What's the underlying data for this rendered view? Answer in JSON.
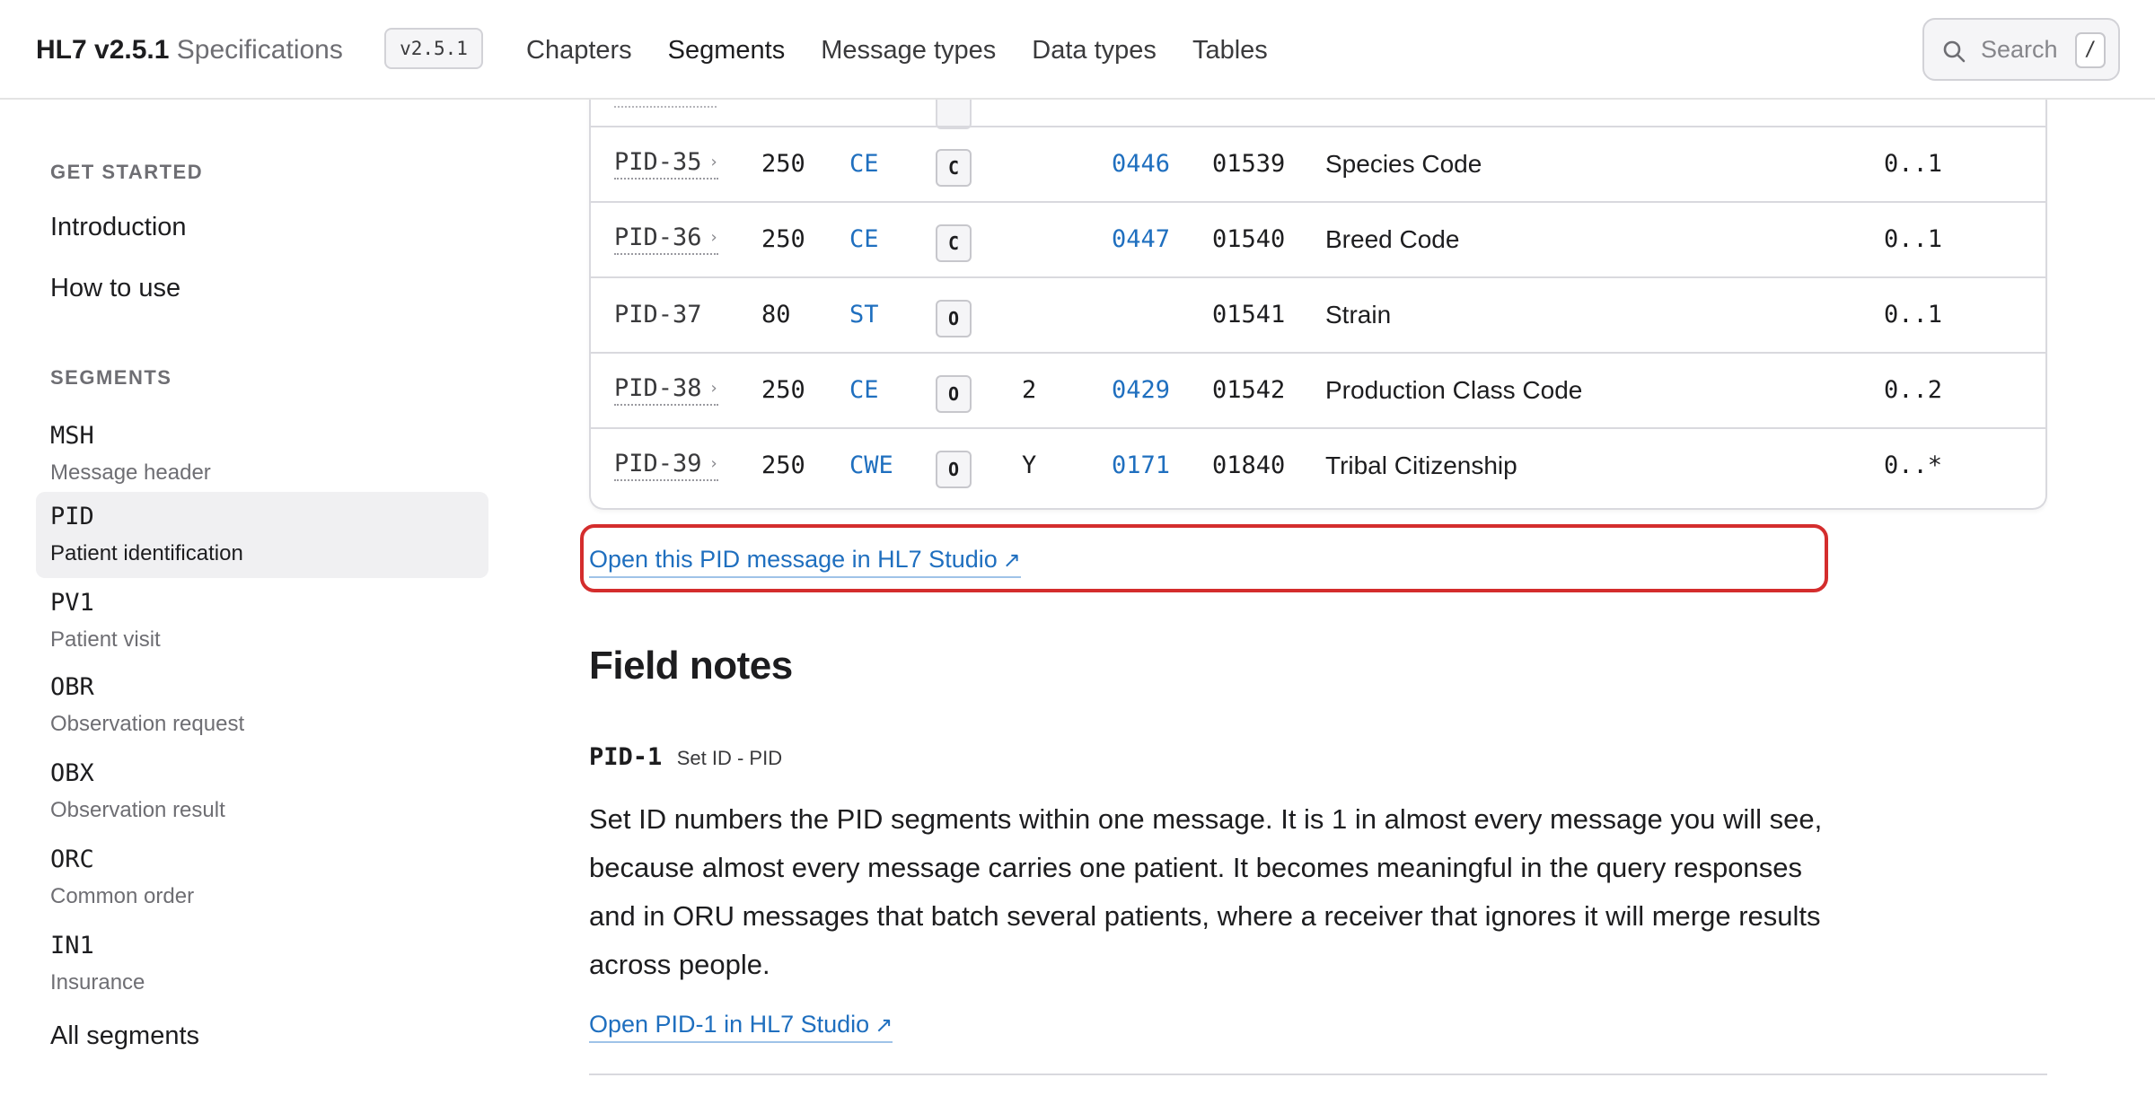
{
  "header": {
    "brand_strong": "HL7 v2.5.1",
    "brand_light": "Specifications",
    "version": "v2.5.1",
    "nav": [
      "Chapters",
      "Segments",
      "Message types",
      "Data types",
      "Tables"
    ],
    "active_nav": "Segments",
    "search": {
      "label": "Search",
      "shortcut": "/"
    }
  },
  "sidebar": {
    "get_started_heading": "GET STARTED",
    "introduction": "Introduction",
    "how_to_use": "How to use",
    "segments_heading": "SEGMENTS",
    "segments": [
      {
        "code": "MSH",
        "desc": "Message header"
      },
      {
        "code": "PID",
        "desc": "Patient identification"
      },
      {
        "code": "PV1",
        "desc": "Patient visit"
      },
      {
        "code": "OBR",
        "desc": "Observation request"
      },
      {
        "code": "OBX",
        "desc": "Observation result"
      },
      {
        "code": "ORC",
        "desc": "Common order"
      },
      {
        "code": "IN1",
        "desc": "Insurance"
      }
    ],
    "active_segment": "PID",
    "all_segments": "All segments"
  },
  "fields_table": {
    "rows": [
      {
        "field": "PID-35",
        "linked": true,
        "len": "250",
        "dt": "CE",
        "opt": "C",
        "rep": "",
        "table": "0446",
        "item": "01539",
        "name": "Species Code",
        "card": "0..1"
      },
      {
        "field": "PID-36",
        "linked": true,
        "len": "250",
        "dt": "CE",
        "opt": "C",
        "rep": "",
        "table": "0447",
        "item": "01540",
        "name": "Breed Code",
        "card": "0..1"
      },
      {
        "field": "PID-37",
        "linked": false,
        "len": "80",
        "dt": "ST",
        "opt": "O",
        "rep": "",
        "table": "",
        "item": "01541",
        "name": "Strain",
        "card": "0..1"
      },
      {
        "field": "PID-38",
        "linked": true,
        "len": "250",
        "dt": "CE",
        "opt": "O",
        "rep": "2",
        "table": "0429",
        "item": "01542",
        "name": "Production Class Code",
        "card": "0..2"
      },
      {
        "field": "PID-39",
        "linked": true,
        "len": "250",
        "dt": "CWE",
        "opt": "O",
        "rep": "Y",
        "table": "0171",
        "item": "01840",
        "name": "Tribal Citizenship",
        "card": "0..*"
      }
    ],
    "chevron": "›"
  },
  "open_studio_link": "Open this PID message in HL7 Studio",
  "link_arrow": "↗",
  "field_notes": {
    "title": "Field notes",
    "code": "PID-1",
    "subtitle": "Set ID - PID",
    "body": "Set ID numbers the PID segments within one message. It is 1 in almost every message you will see, because almost every message carries one patient. It becomes meaningful in the query responses and in ORU messages that batch several patients, where a receiver that ignores it will merge results across people.",
    "link": "Open PID-1 in HL7 Studio"
  },
  "colors": {
    "link": "#1f6fbf",
    "highlight": "#d42d2d",
    "border": "#d9d9de"
  }
}
